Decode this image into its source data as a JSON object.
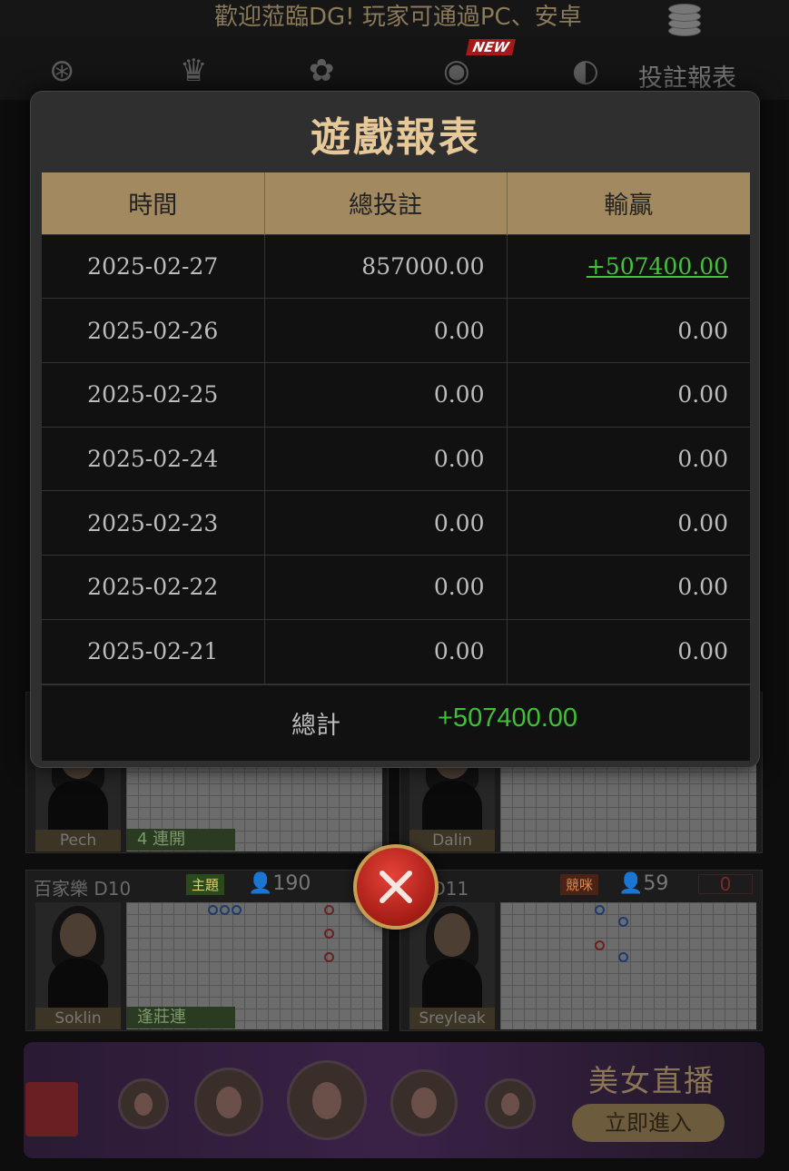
{
  "marquee": "歡迎蒞臨DG! 玩家可通過PC、安卓",
  "nav": {
    "new_badge": "NEW",
    "report_label": "投註報表",
    "icons": [
      "chip-icon",
      "crown-icon",
      "lingerie-icon",
      "new-game-icon",
      "partial-icon"
    ]
  },
  "modal": {
    "title": "遊戲報表",
    "columns": [
      "時間",
      "總投註",
      "輸贏"
    ],
    "rows": [
      {
        "date": "2025-02-27",
        "bet": "857000.00",
        "result": "+507400.00"
      },
      {
        "date": "2025-02-26",
        "bet": "0.00",
        "result": "0.00"
      },
      {
        "date": "2025-02-25",
        "bet": "0.00",
        "result": "0.00"
      },
      {
        "date": "2025-02-24",
        "bet": "0.00",
        "result": "0.00"
      },
      {
        "date": "2025-02-23",
        "bet": "0.00",
        "result": "0.00"
      },
      {
        "date": "2025-02-22",
        "bet": "0.00",
        "result": "0.00"
      },
      {
        "date": "2025-02-21",
        "bet": "0.00",
        "result": "0.00"
      }
    ],
    "total_label": "總計",
    "total_value": "+507400.00"
  },
  "tables": [
    {
      "dealer": "Pech",
      "strip": "4 連開"
    },
    {
      "dealer": "Dalin",
      "strip": ""
    },
    {
      "title": "百家樂 D10",
      "badge": "主題",
      "count": "190",
      "dealer": "Soklin",
      "strip": "逢莊連"
    },
    {
      "title": "樂 D11",
      "badge": "競咪",
      "count": "59",
      "zero": "0",
      "dealer": "Sreyleak",
      "strip": ""
    }
  ],
  "promo": {
    "title": "美女直播",
    "button": "立即進入"
  },
  "colors": {
    "accent_gold": "#e7c999",
    "header_bg": "#a2895f",
    "win_green": "#44c23a",
    "close_red": "#c7281e"
  }
}
